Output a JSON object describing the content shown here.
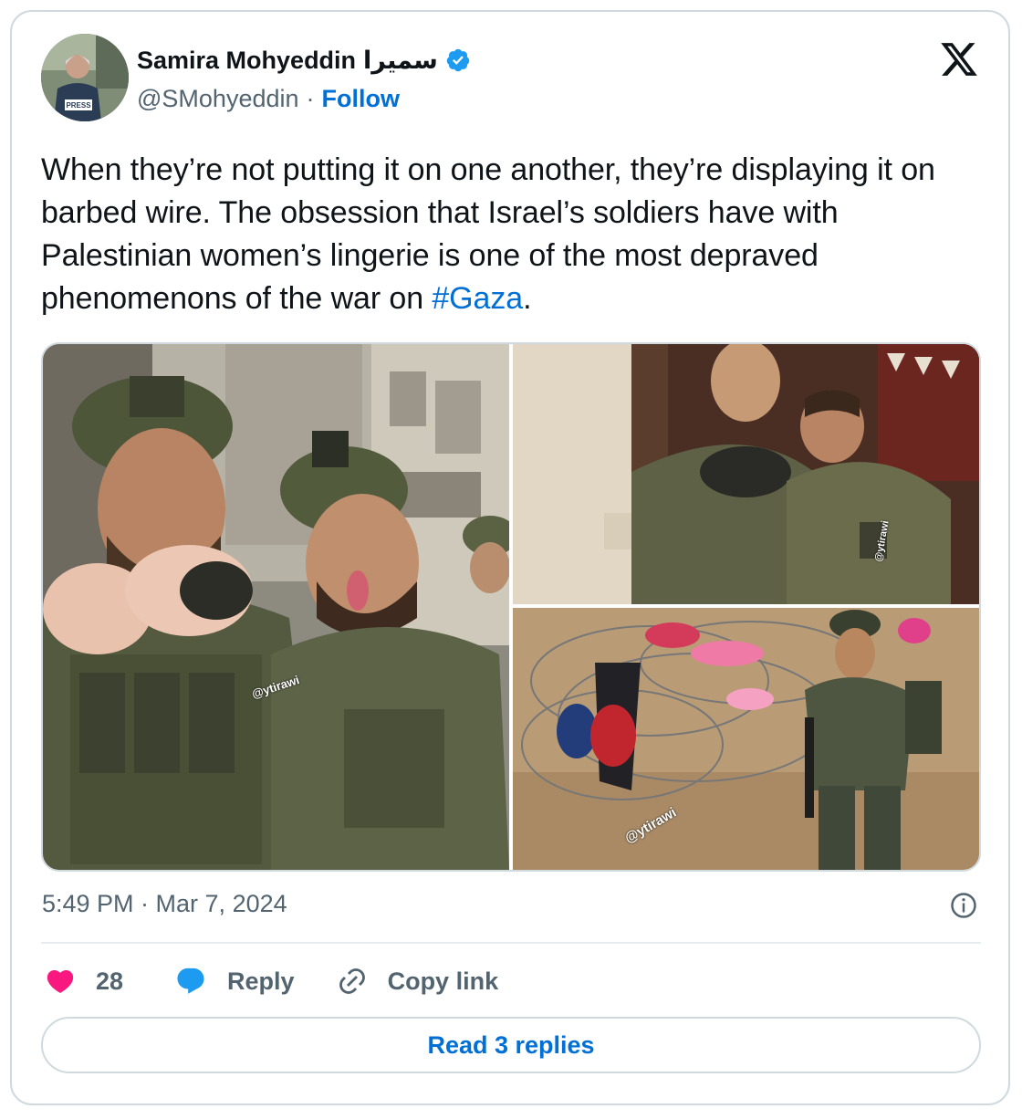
{
  "author": {
    "display_name": "Samira Mohyeddin",
    "display_name_arabic": "سميرا",
    "handle": "@SMohyeddin",
    "separator": "·",
    "follow_label": "Follow",
    "avatar_badge_text": "PRESS",
    "verified": true
  },
  "tweet": {
    "text_before_hashtag": "When they’re not putting it on one another, they’re displaying it on barbed wire. The obsession that Israel’s soldiers have with Palestinian women’s lingerie is one of the most depraved phenomenons of the war on ",
    "hashtag": "#Gaza",
    "text_after_hashtag": "."
  },
  "media": {
    "watermarks": [
      "@ytirawi",
      "@ytirawi",
      "@ytirawi"
    ]
  },
  "meta": {
    "timestamp": "5:49 PM · Mar 7, 2024"
  },
  "actions": {
    "like_count": "28",
    "reply_label": "Reply",
    "copy_link_label": "Copy link"
  },
  "footer": {
    "read_replies_label": "Read 3 replies"
  },
  "colors": {
    "link": "#006fd6",
    "secondary_text": "#536471",
    "border": "#cfd9de",
    "like": "#f91880",
    "reply": "#1d9bf0",
    "verified": "#1d9bf0"
  },
  "icons": {
    "platform_logo": "x-logo-icon",
    "verified": "verified-badge-icon",
    "info": "info-icon",
    "like": "heart-icon",
    "reply": "speech-bubble-icon",
    "copy_link": "link-icon"
  }
}
